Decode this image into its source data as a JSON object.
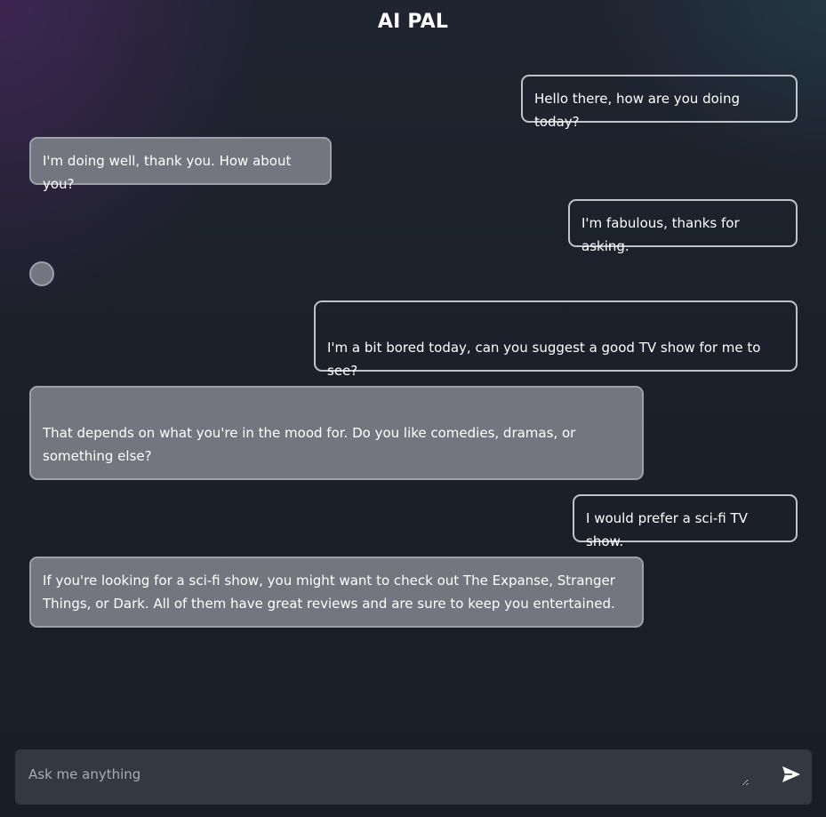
{
  "app": {
    "title": "AI PAL"
  },
  "conversation": {
    "messages": [
      {
        "role": "user",
        "text": "Hello there, how are you doing today?"
      },
      {
        "role": "assistant",
        "text": "I'm doing well, thank you. How about you?"
      },
      {
        "role": "user",
        "text": "I'm fabulous, thanks for asking."
      },
      {
        "role": "assistant",
        "text": ""
      },
      {
        "role": "user",
        "text": "I'm a bit bored today, can you suggest a good TV show for me to see?"
      },
      {
        "role": "assistant",
        "text": "That depends on what you're in the mood for. Do you like comedies, dramas, or something else?"
      },
      {
        "role": "user",
        "text": "I would prefer a sci-fi TV show."
      },
      {
        "role": "assistant",
        "text": "If you're looking for a sci-fi show, you might want to check out The Expanse, Stranger Things, or Dark. All of them have great reviews and are sure to keep you entertained."
      }
    ]
  },
  "composer": {
    "placeholder": "Ask me anything",
    "value": "",
    "send_icon": "send-icon"
  },
  "colors": {
    "background": "#1b2029",
    "user_bubble_border": "#bfc3ca",
    "bot_bubble_fill": "#73767e",
    "composer_fill": "#343941"
  }
}
